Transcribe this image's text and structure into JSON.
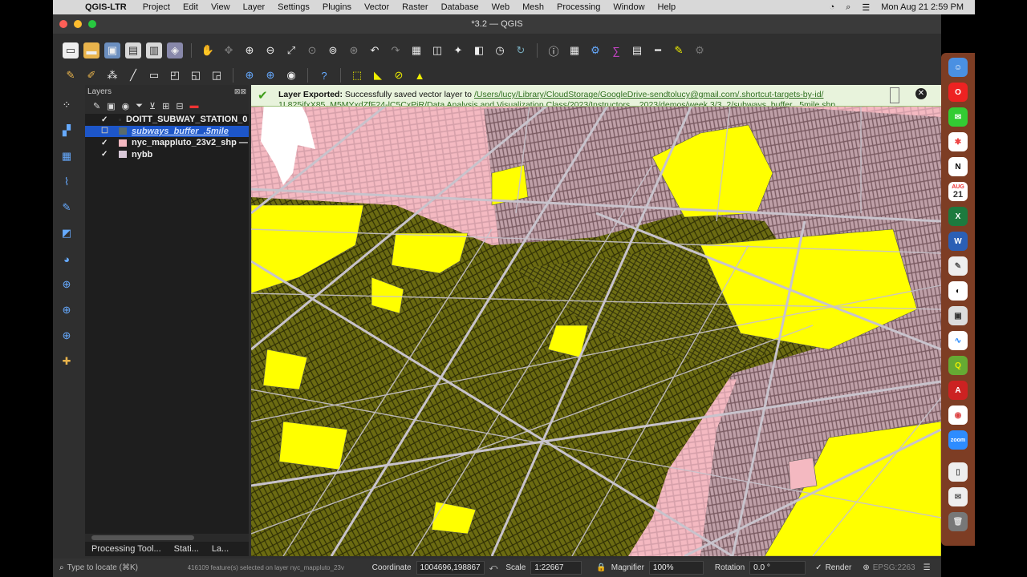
{
  "menubar": {
    "app": "QGIS-LTR",
    "items": [
      "Project",
      "Edit",
      "View",
      "Layer",
      "Settings",
      "Plugins",
      "Vector",
      "Raster",
      "Database",
      "Web",
      "Mesh",
      "Processing",
      "Window",
      "Help"
    ],
    "clock": "Mon Aug 21  2:59 PM"
  },
  "window": {
    "title": "*3.2 — QGIS"
  },
  "layers_panel": {
    "title": "Layers",
    "layers": [
      {
        "name": "DOITT_SUBWAY_STATION_0",
        "checked": true,
        "color": "#2f2f2f",
        "selected": false
      },
      {
        "name": "subways_buffer_.5mile",
        "checked": false,
        "color": "#5a6b6b",
        "selected": true
      },
      {
        "name": "nyc_mappluto_23v2_shp —",
        "checked": true,
        "color": "#f4b9c1",
        "selected": false
      },
      {
        "name": "nybb",
        "checked": true,
        "color": "#d9c9d8",
        "selected": false
      }
    ]
  },
  "bottom_tabs": [
    "Processing Tool...",
    "Stati...",
    "La..."
  ],
  "message": {
    "label": "Layer Exported:",
    "text": " Successfully saved vector layer to ",
    "path": "/Users/lucy/Library/CloudStorage/GoogleDrive-sendtolucy@gmail.com/.shortcut-targets-by-id/",
    "path_line2": "1L825ifxX85_M5MYxdZfF24-lC5CxPiR/Data Analysis and Visualization Class/2023/Instructors... 2023/demos/week 3/3_2/subways_buffer_.5mile.shp"
  },
  "statusbar": {
    "locate_placeholder": "Type to locate (⌘K)",
    "selection": "416109 feature(s) selected on layer nyc_mappluto_23v",
    "coordinate_label": "Coordinate",
    "coordinate": "1004696,198867",
    "scale_label": "Scale",
    "scale": "1:22667",
    "magnifier_label": "Magnifier",
    "magnifier": "100%",
    "rotation_label": "Rotation",
    "rotation": "0.0 °",
    "render_label": "Render",
    "crs": "EPSG:2263"
  },
  "colors": {
    "pink": "#f4b9c1",
    "yellow": "#ffff00",
    "olive": "#6b6b12",
    "road": "#c8c3cc"
  },
  "dock": {
    "calendar_day": "21",
    "calendar_month": "AUG",
    "zoom_label": "zoom"
  }
}
